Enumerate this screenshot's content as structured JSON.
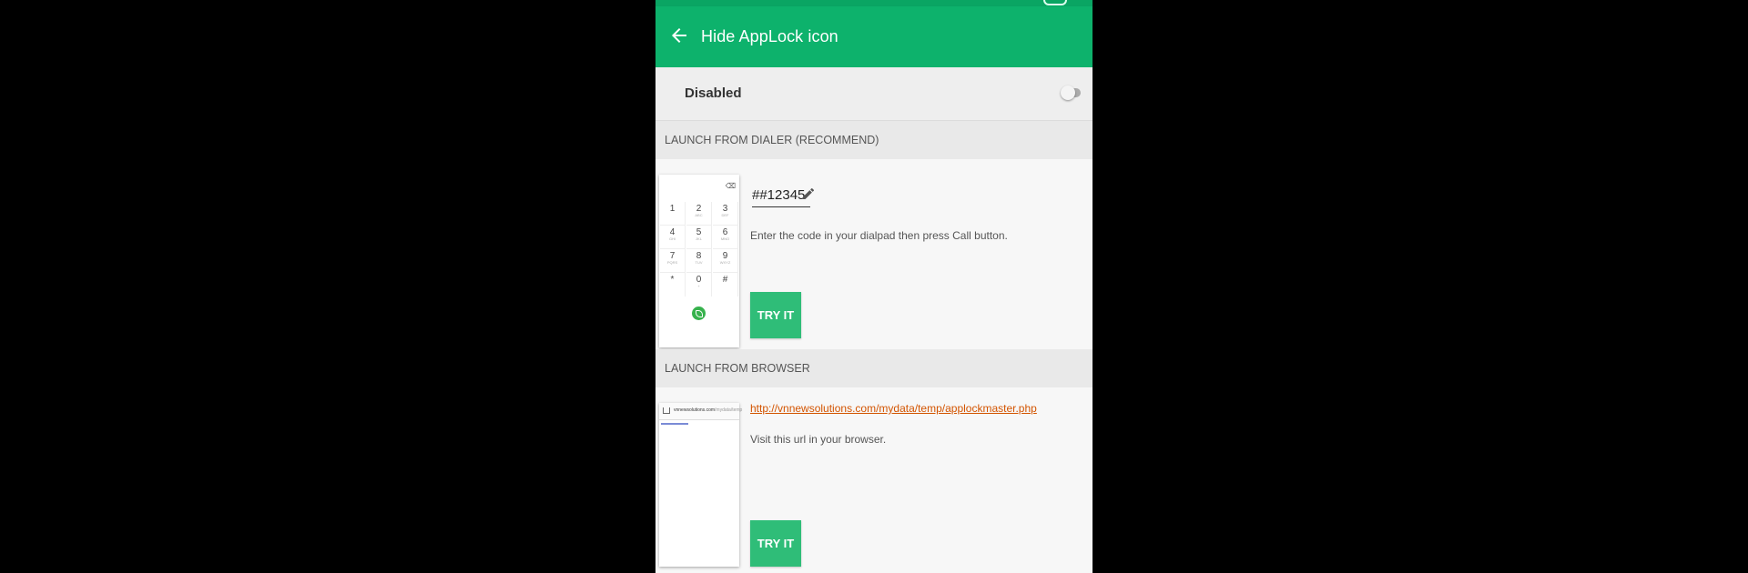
{
  "toolbar": {
    "title": "Hide AppLock icon"
  },
  "toggle": {
    "label": "Disabled",
    "state": "off"
  },
  "dialer_section": {
    "header": "LAUNCH FROM DIALER (RECOMMEND)",
    "code": "##12345",
    "hint": "Enter the code in your dialpad then press Call button.",
    "try_label": "TRY IT",
    "dialpad": {
      "keys": [
        {
          "digit": "1",
          "letters": ""
        },
        {
          "digit": "2",
          "letters": "ABC"
        },
        {
          "digit": "3",
          "letters": "DEF"
        },
        {
          "digit": "4",
          "letters": "GHI"
        },
        {
          "digit": "5",
          "letters": "JKL"
        },
        {
          "digit": "6",
          "letters": "MNO"
        },
        {
          "digit": "7",
          "letters": "PQRS"
        },
        {
          "digit": "8",
          "letters": "TUV"
        },
        {
          "digit": "9",
          "letters": "WXYZ"
        },
        {
          "digit": "*",
          "letters": ""
        },
        {
          "digit": "0",
          "letters": "+"
        },
        {
          "digit": "#",
          "letters": ""
        }
      ],
      "delete_glyph": "⌫"
    }
  },
  "browser_section": {
    "header": "LAUNCH FROM BROWSER",
    "url": "http://vnnewsolutions.com/mydata/temp/applockmaster.php",
    "hint": "Visit this url in your browser.",
    "try_label": "TRY IT",
    "thumbnail": {
      "domain": "vnnewsolutions.com",
      "path": "/mydata/temp"
    }
  },
  "colors": {
    "toolbar": "#0db26c",
    "button": "#2fbd78",
    "link": "#d35400"
  },
  "icons": [
    "back-arrow-icon",
    "pencil-icon",
    "phone-call-icon",
    "home-icon",
    "backspace-icon"
  ]
}
